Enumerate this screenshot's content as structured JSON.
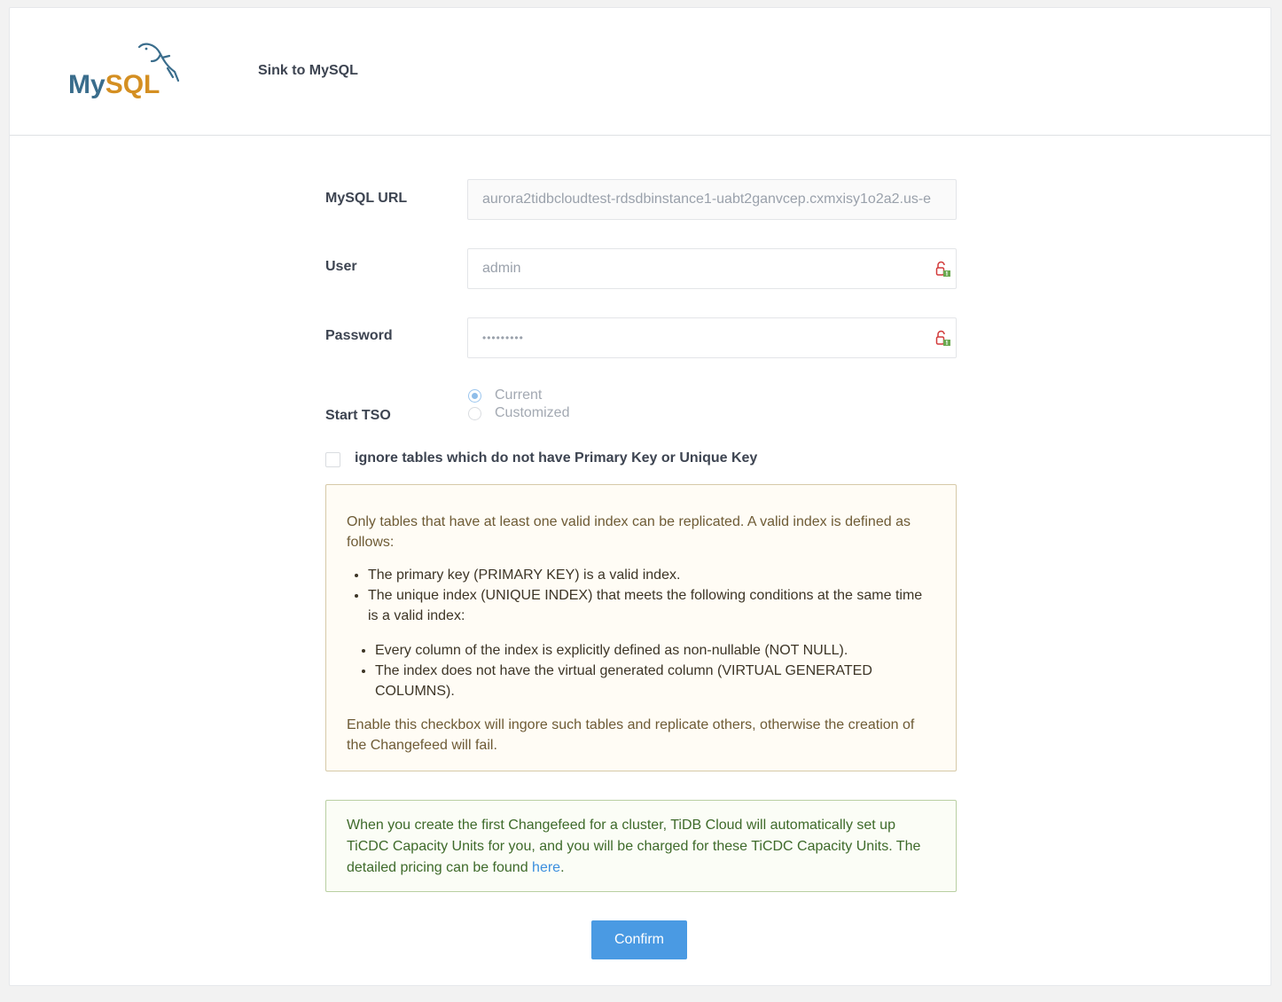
{
  "header": {
    "logo_my": "My",
    "logo_sql": "SQL",
    "title": "Sink to MySQL"
  },
  "form": {
    "url_label": "MySQL URL",
    "url_value": "aurora2tidbcloudtest-rdsdbinstance1-uabt2ganvcep.cxmxisy1o2a2.us-e",
    "user_label": "User",
    "user_value": "admin",
    "password_label": "Password",
    "password_value": "•••••••••",
    "start_tso_label": "Start TSO",
    "tso_options": [
      "Current",
      "Customized"
    ],
    "tso_selected": "Current",
    "ignore_checkbox_label": "ignore tables which do not have Primary Key or Unique Key"
  },
  "warning": {
    "intro": "Only tables that have at least one valid index can be replicated. A valid index is defined as follows:",
    "items": [
      "The primary key (PRIMARY KEY) is a valid index.",
      "The unique index (UNIQUE INDEX) that meets the following conditions at the same time is a valid index:"
    ],
    "subitems": [
      "Every column of the index is explicitly defined as non-nullable (NOT NULL).",
      "The index does not have the virtual generated column (VIRTUAL GENERATED COLUMNS)."
    ],
    "outro": "Enable this checkbox will ingore such tables and replicate others, otherwise the creation of the Changefeed will fail."
  },
  "info": {
    "text": "When you create the first Changefeed for a cluster, TiDB Cloud will automatically set up TiCDC Capacity Units for you, and you will be charged for these TiCDC Capacity Units. The detailed pricing can be found ",
    "link": "here",
    "suffix": "."
  },
  "confirm_label": "Confirm",
  "colors": {
    "primary": "#4a9ae3",
    "warning_bg": "#fffcf5",
    "info_bg": "#fbfdf6",
    "logo_blue": "#3a6d8c",
    "logo_orange": "#d48f22"
  },
  "icons": [
    "mysql-dolphin-icon",
    "password-manager-icon"
  ]
}
